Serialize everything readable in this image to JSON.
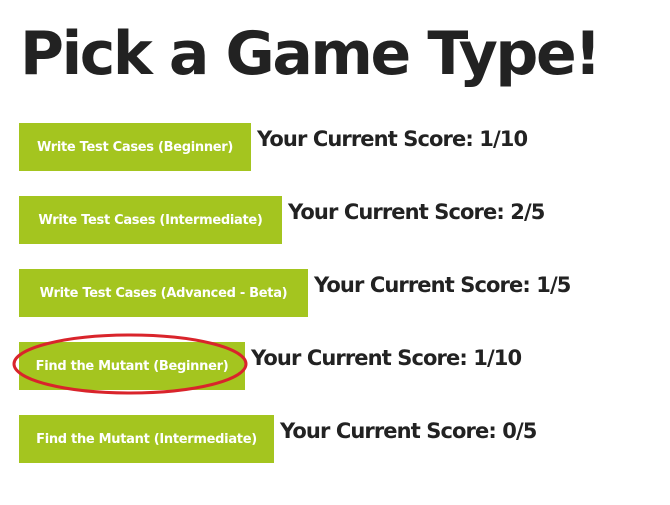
{
  "header": {
    "title": "Pick a Game Type!"
  },
  "games": [
    {
      "button_label": "Write Test Cases (Beginner)",
      "score_text": "Your Current Score: 1/10"
    },
    {
      "button_label": "Write Test Cases (Intermediate)",
      "score_text": "Your Current Score: 2/5"
    },
    {
      "button_label": "Write Test Cases (Advanced - Beta)",
      "score_text": "Your Current Score: 1/5"
    },
    {
      "button_label": "Find the Mutant (Beginner)",
      "score_text": "Your Current Score: 1/10"
    },
    {
      "button_label": "Find the Mutant (Intermediate)",
      "score_text": "Your Current Score: 0/5"
    }
  ],
  "colors": {
    "button_background": "#a4c51f",
    "button_text": "#ffffff",
    "highlight_ellipse": "#d9242b",
    "text": "#222222"
  }
}
